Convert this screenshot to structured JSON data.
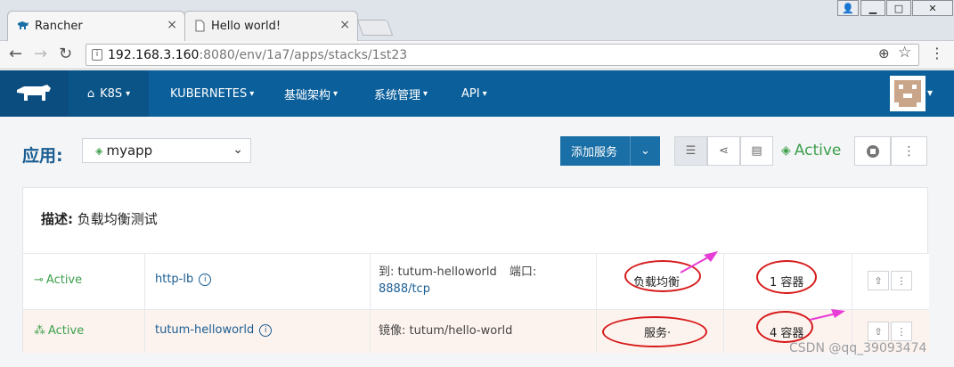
{
  "browser": {
    "tabs": [
      {
        "label": "Rancher",
        "icon": "rancher-icon"
      },
      {
        "label": "Hello world!",
        "icon": "page-icon"
      }
    ],
    "window_controls": [
      "user",
      "minimize",
      "maximize",
      "close"
    ],
    "url_host": "192.168.3.160",
    "url_path": ":8080/env/1a7/apps/stacks/1st23"
  },
  "navbar": {
    "environment": "K8S",
    "items": [
      "KUBERNETES",
      "基础架构",
      "系统管理",
      "API"
    ],
    "accent": "#0b5f9a"
  },
  "stack": {
    "label": "应用:",
    "selected": "myapp",
    "add_service": "添加服务",
    "status": "Active",
    "status_color": "#3c9f4b",
    "description_label": "描述:",
    "description": "负载均衡测试"
  },
  "services": [
    {
      "state": "Active",
      "name": "http-lb",
      "detail_prefix": "到:",
      "detail_target": "tutum-helloworld",
      "detail_port_label": "端口:",
      "detail_port": "8888/tcp",
      "kind": "负载均衡",
      "containers": "1 容器"
    },
    {
      "state": "Active",
      "name": "tutum-helloworld",
      "detail_prefix": "镜像:",
      "detail_target": "tutum/hello-world",
      "kind": "服务·",
      "containers": "4 容器"
    }
  ],
  "watermark": "CSDN @qq_39093474"
}
